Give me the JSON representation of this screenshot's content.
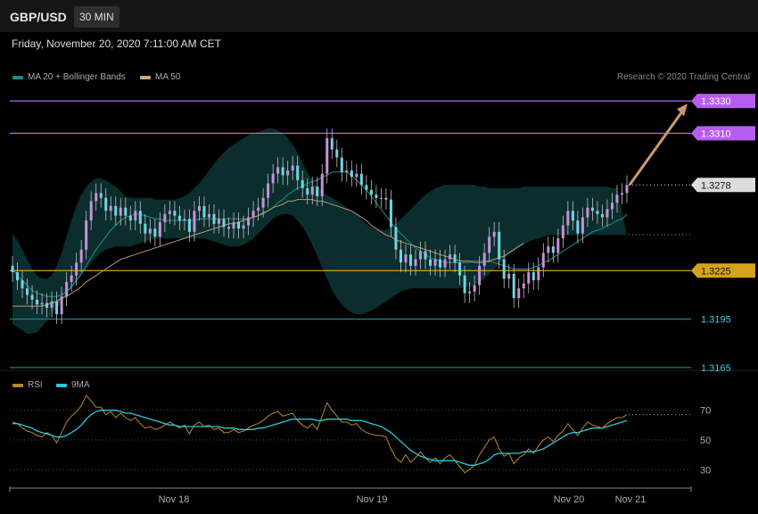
{
  "header": {
    "pair": "GBP/USD",
    "interval": "30 MIN"
  },
  "datetime": "Friday, November 20, 2020 7:11:00 AM CET",
  "legend": {
    "bollinger": {
      "label": "MA 20 + Bollinger Bands",
      "color": "#1b8b8b"
    },
    "ma50": {
      "label": "MA 50",
      "color": "#c9a77d"
    }
  },
  "credit": "Research © 2020 Trading Central",
  "rsi_legend": {
    "rsi": {
      "label": "RSI",
      "color": "#b8862e"
    },
    "ma9": {
      "label": "9MA",
      "color": "#28c9d8"
    }
  },
  "colors": {
    "up": "#c890d8",
    "down": "#6fd6e0",
    "resistance": "#b65cf0",
    "support": "#d6a21a",
    "support_below": "#1d7f80",
    "arrow": "#c99a6e",
    "last": "#dcdcdc"
  },
  "chart_data": [
    {
      "type": "candlestick",
      "title": "GBP/USD 30 MIN",
      "ylim": [
        1.3155,
        1.3345
      ],
      "x_ticks": [
        "Nov 18",
        "Nov 19",
        "Nov 20",
        "Nov 21"
      ],
      "levels": [
        {
          "value": 1.333,
          "label": "1.3330",
          "kind": "resistance"
        },
        {
          "value": 1.331,
          "label": "1.3310",
          "kind": "resistance"
        },
        {
          "value": 1.3278,
          "label": "1.3278",
          "kind": "last"
        },
        {
          "value": 1.3225,
          "label": "1.3225",
          "kind": "pivot"
        },
        {
          "value": 1.3195,
          "label": "1.3195",
          "kind": "support"
        },
        {
          "value": 1.3165,
          "label": "1.3165",
          "kind": "support"
        }
      ],
      "closes": [
        1.3224,
        1.3219,
        1.3214,
        1.321,
        1.3207,
        1.3204,
        1.3205,
        1.3202,
        1.3206,
        1.3198,
        1.3209,
        1.3218,
        1.3222,
        1.323,
        1.3238,
        1.3256,
        1.3268,
        1.3273,
        1.327,
        1.3262,
        1.3265,
        1.3259,
        1.3264,
        1.3259,
        1.3256,
        1.3262,
        1.3254,
        1.3248,
        1.3251,
        1.3246,
        1.3255,
        1.326,
        1.3262,
        1.3259,
        1.3256,
        1.3257,
        1.3249,
        1.3262,
        1.3265,
        1.3258,
        1.326,
        1.3254,
        1.3257,
        1.3252,
        1.3251,
        1.3255,
        1.3251,
        1.3253,
        1.3258,
        1.3262,
        1.3264,
        1.327,
        1.3279,
        1.3285,
        1.3289,
        1.3284,
        1.3287,
        1.329,
        1.3281,
        1.3276,
        1.3272,
        1.3277,
        1.3271,
        1.3285,
        1.3307,
        1.33,
        1.3295,
        1.3286,
        1.3287,
        1.3283,
        1.3285,
        1.3278,
        1.3275,
        1.3272,
        1.327,
        1.327,
        1.3269,
        1.3252,
        1.3238,
        1.323,
        1.3235,
        1.3228,
        1.3232,
        1.3237,
        1.3232,
        1.3228,
        1.3232,
        1.3227,
        1.3232,
        1.3235,
        1.323,
        1.3222,
        1.3211,
        1.3212,
        1.3216,
        1.3228,
        1.3236,
        1.3246,
        1.3249,
        1.3232,
        1.322,
        1.3223,
        1.3208,
        1.3214,
        1.3217,
        1.3224,
        1.3219,
        1.3227,
        1.3236,
        1.324,
        1.3236,
        1.3245,
        1.3253,
        1.3262,
        1.3256,
        1.3248,
        1.3258,
        1.3264,
        1.3262,
        1.326,
        1.3258,
        1.3263,
        1.3267,
        1.3272,
        1.3273,
        1.3278
      ],
      "ma20": [
        1.3226,
        1.3222,
        1.3219,
        1.3216,
        1.3213,
        1.3211,
        1.321,
        1.3209,
        1.3209,
        1.3209,
        1.321,
        1.3212,
        1.3215,
        1.3219,
        1.3223,
        1.3228,
        1.3233,
        1.3238,
        1.3242,
        1.3246,
        1.325,
        1.3253,
        1.3256,
        1.3258,
        1.3259,
        1.326,
        1.326,
        1.3259,
        1.3258,
        1.3257,
        1.3257,
        1.3256,
        1.3256,
        1.3256,
        1.3256,
        1.3256,
        1.3256,
        1.3256,
        1.3257,
        1.3257,
        1.3257,
        1.3257,
        1.3257,
        1.3257,
        1.3257,
        1.3257,
        1.3257,
        1.3257,
        1.3257,
        1.3258,
        1.3259,
        1.326,
        1.3262,
        1.3264,
        1.3267,
        1.3269,
        1.3272,
        1.3274,
        1.3276,
        1.3277,
        1.3279,
        1.328,
        1.3281,
        1.3283,
        1.3284,
        1.3286,
        1.3286,
        1.3286,
        1.3286,
        1.3284,
        1.3281,
        1.3278,
        1.3275,
        1.3271,
        1.3267,
        1.3263,
        1.3259,
        1.3255,
        1.3251,
        1.3248,
        1.3245,
        1.3242,
        1.3239,
        1.3237,
        1.3235,
        1.3233,
        1.3232,
        1.3231,
        1.323,
        1.323,
        1.323,
        1.323,
        1.323,
        1.323,
        1.3231,
        1.3231,
        1.3231,
        1.3231,
        1.323,
        1.3229,
        1.3228,
        1.3227,
        1.3226,
        1.3226,
        1.3226,
        1.3226,
        1.3227,
        1.3228,
        1.323,
        1.3231,
        1.3233,
        1.3235,
        1.3237,
        1.3239,
        1.3241,
        1.3243,
        1.3245,
        1.3247,
        1.3249,
        1.325,
        1.3251,
        1.3253,
        1.3254,
        1.3256,
        1.3257,
        1.326
      ],
      "ma50": [
        1.3203,
        1.3203,
        1.3203,
        1.3203,
        1.3203,
        1.3203,
        1.3203,
        1.3204,
        1.3205,
        1.3206,
        1.3208,
        1.3209,
        1.3211,
        1.3213,
        1.3215,
        1.3218,
        1.322,
        1.3222,
        1.3224,
        1.3226,
        1.3228,
        1.323,
        1.3232,
        1.3233,
        1.3234,
        1.3235,
        1.3236,
        1.3237,
        1.3238,
        1.3239,
        1.324,
        1.3241,
        1.3242,
        1.3243,
        1.3244,
        1.3245,
        1.3246,
        1.3247,
        1.3248,
        1.3249,
        1.325,
        1.3251,
        1.3252,
        1.3253,
        1.3254,
        1.3254,
        1.3255,
        1.3256,
        1.3257,
        1.3258,
        1.3259,
        1.3261,
        1.3262,
        1.3264,
        1.3265,
        1.3266,
        1.3268,
        1.3268,
        1.3269,
        1.3269,
        1.3269,
        1.3269,
        1.3268,
        1.3268,
        1.3267,
        1.3266,
        1.3265,
        1.3264,
        1.3263,
        1.3262,
        1.326,
        1.3258,
        1.3256,
        1.3253,
        1.3251,
        1.3249,
        1.3247,
        1.3246,
        1.3244,
        1.3243,
        1.3242,
        1.3241,
        1.324,
        1.3239,
        1.3238,
        1.3237,
        1.3236,
        1.3235,
        1.3234,
        1.3233,
        1.3232,
        1.3231,
        1.3231,
        1.3231,
        1.323,
        1.323,
        1.323,
        1.3231,
        1.3232,
        1.3233,
        1.3234,
        1.3236,
        1.3238,
        1.324,
        1.3242
      ],
      "bb_upper": [
        1.3248,
        1.3244,
        1.3238,
        1.3232,
        1.3226,
        1.3222,
        1.322,
        1.322,
        1.3222,
        1.3228,
        1.3236,
        1.3246,
        1.3256,
        1.3265,
        1.3272,
        1.3277,
        1.328,
        1.3282,
        1.3282,
        1.3281,
        1.3279,
        1.3277,
        1.3274,
        1.3271,
        1.327,
        1.327,
        1.327,
        1.327,
        1.327,
        1.3269,
        1.3269,
        1.3269,
        1.3269,
        1.3269,
        1.327,
        1.3271,
        1.3273,
        1.3276,
        1.3279,
        1.3283,
        1.3287,
        1.3291,
        1.3295,
        1.3298,
        1.3301,
        1.3303,
        1.3305,
        1.3307,
        1.3309,
        1.331,
        1.3311,
        1.3312,
        1.3313,
        1.3313,
        1.3312,
        1.331,
        1.3307,
        1.3303,
        1.3298,
        1.3292,
        1.3286,
        1.3281,
        1.3277,
        1.3274,
        1.3272,
        1.327,
        1.3268,
        1.3266,
        1.3264,
        1.3262,
        1.326,
        1.3257,
        1.3254,
        1.3252,
        1.3251,
        1.325,
        1.325,
        1.3252,
        1.3254,
        1.3257,
        1.326,
        1.3263,
        1.3266,
        1.3269,
        1.3272,
        1.3274,
        1.3276,
        1.3277,
        1.3278,
        1.3278,
        1.3278,
        1.3278,
        1.3278,
        1.3278,
        1.3278,
        1.3277,
        1.3277,
        1.3276,
        1.3276,
        1.3276,
        1.3276,
        1.3276,
        1.3276,
        1.3276,
        1.3277,
        1.3277,
        1.3277,
        1.3277,
        1.3277,
        1.3277,
        1.3277,
        1.3277,
        1.3277,
        1.3277,
        1.3277,
        1.3277,
        1.3277,
        1.3277,
        1.3277,
        1.3277,
        1.3277,
        1.3277,
        1.3276,
        1.3276
      ],
      "bb_lower": [
        1.3192,
        1.319,
        1.3188,
        1.3186,
        1.3186,
        1.3187,
        1.319,
        1.3194,
        1.3198,
        1.3202,
        1.3206,
        1.321,
        1.3214,
        1.3218,
        1.3222,
        1.3226,
        1.323,
        1.3233,
        1.3236,
        1.3238,
        1.3239,
        1.324,
        1.324,
        1.324,
        1.324,
        1.3241,
        1.3242,
        1.3243,
        1.3244,
        1.3245,
        1.3245,
        1.3245,
        1.3245,
        1.3245,
        1.3245,
        1.3245,
        1.3245,
        1.3245,
        1.3245,
        1.3245,
        1.3244,
        1.3243,
        1.3242,
        1.3241,
        1.324,
        1.324,
        1.324,
        1.3241,
        1.3243,
        1.3245,
        1.3248,
        1.3251,
        1.3254,
        1.3257,
        1.3259,
        1.326,
        1.326,
        1.3259,
        1.3256,
        1.3252,
        1.3247,
        1.3241,
        1.3234,
        1.3227,
        1.322,
        1.3213,
        1.3208,
        1.3204,
        1.3201,
        1.3199,
        1.3198,
        1.3198,
        1.3199,
        1.32,
        1.3202,
        1.3204,
        1.3206,
        1.3208,
        1.321,
        1.3212,
        1.3213,
        1.3214,
        1.3214,
        1.3214,
        1.3214,
        1.3214,
        1.3214,
        1.3214,
        1.3214,
        1.3214,
        1.3214,
        1.3214,
        1.3215,
        1.3215,
        1.3216,
        1.3218,
        1.322,
        1.3223,
        1.3226,
        1.3229,
        1.3232,
        1.3235,
        1.3237,
        1.3239,
        1.3241,
        1.3243,
        1.3244,
        1.3245,
        1.3246,
        1.3247,
        1.3247,
        1.3247,
        1.3247,
        1.3247,
        1.3247,
        1.3247,
        1.3247,
        1.3247,
        1.3247,
        1.3247,
        1.3247,
        1.3247,
        1.3247,
        1.3247,
        1.3247,
        1.3247
      ]
    },
    {
      "type": "line",
      "title": "RSI",
      "ylim": [
        20,
        80
      ],
      "y_ticks": [
        30,
        50,
        70
      ],
      "series": [
        {
          "name": "RSI",
          "values": [
            62,
            61,
            58,
            56,
            55,
            53,
            52,
            55,
            53,
            48,
            55,
            62,
            66,
            69,
            73,
            80,
            76,
            72,
            72,
            67,
            69,
            65,
            68,
            65,
            63,
            65,
            61,
            58,
            59,
            57,
            58,
            60,
            62,
            60,
            58,
            60,
            54,
            60,
            62,
            59,
            60,
            57,
            58,
            55,
            55,
            57,
            55,
            56,
            58,
            60,
            61,
            63,
            66,
            68,
            69,
            66,
            67,
            68,
            63,
            60,
            58,
            61,
            57,
            66,
            75,
            70,
            66,
            62,
            62,
            60,
            61,
            57,
            55,
            54,
            53,
            53,
            52,
            44,
            38,
            35,
            40,
            35,
            38,
            42,
            38,
            35,
            38,
            34,
            38,
            40,
            36,
            32,
            28,
            30,
            33,
            40,
            45,
            50,
            52,
            44,
            39,
            41,
            34,
            38,
            40,
            44,
            41,
            46,
            50,
            52,
            49,
            53,
            56,
            61,
            57,
            53,
            58,
            62,
            60,
            59,
            58,
            61,
            63,
            65,
            65,
            67
          ]
        },
        {
          "name": "9MA",
          "values": [
            61,
            61,
            60,
            59,
            58,
            56,
            55,
            54,
            53,
            52,
            52,
            53,
            55,
            57,
            60,
            64,
            67,
            69,
            70,
            70,
            70,
            70,
            69,
            68,
            68,
            67,
            66,
            65,
            64,
            63,
            62,
            61,
            60,
            60,
            59,
            59,
            59,
            59,
            59,
            59,
            59,
            59,
            59,
            58,
            58,
            58,
            57,
            57,
            57,
            57,
            58,
            58,
            59,
            60,
            61,
            62,
            63,
            64,
            64,
            64,
            64,
            64,
            63,
            63,
            64,
            64,
            64,
            64,
            64,
            63,
            63,
            63,
            62,
            61,
            60,
            59,
            57,
            55,
            52,
            49,
            46,
            43,
            41,
            39,
            38,
            37,
            36,
            36,
            36,
            36,
            36,
            35,
            34,
            33,
            33,
            34,
            35,
            37,
            40,
            41,
            41,
            41,
            41,
            41,
            42,
            42,
            42,
            43,
            44,
            46,
            48,
            50,
            52,
            54,
            55,
            55,
            56,
            57,
            58,
            58,
            58,
            59,
            60,
            61,
            62,
            63
          ]
        }
      ]
    }
  ]
}
